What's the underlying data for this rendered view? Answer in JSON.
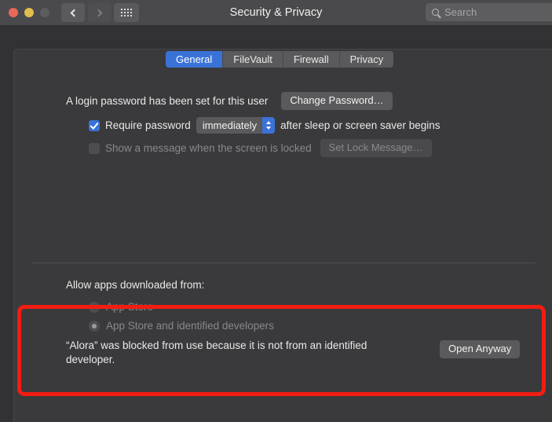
{
  "window": {
    "title": "Security & Privacy",
    "traffic_lights": [
      "close-button",
      "minimize-button",
      "zoom-button"
    ],
    "nav": {
      "back": "back-button",
      "forward": "forward-button",
      "show_all": "show-all-button"
    }
  },
  "search": {
    "placeholder": "Search",
    "value": ""
  },
  "tabs": [
    {
      "label": "General",
      "active": true
    },
    {
      "label": "FileVault",
      "active": false
    },
    {
      "label": "Firewall",
      "active": false
    },
    {
      "label": "Privacy",
      "active": false
    }
  ],
  "general": {
    "login_password_text": "A login password has been set for this user",
    "change_password_label": "Change Password…",
    "require_password": {
      "checked": true,
      "label": "Require password",
      "delay_value": "immediately",
      "suffix": "after sleep or screen saver begins"
    },
    "lock_message": {
      "checked": false,
      "label": "Show a message when the screen is locked",
      "button_label": "Set Lock Message…",
      "enabled": false
    },
    "allow_apps": {
      "heading": "Allow apps downloaded from:",
      "options": [
        {
          "label": "App Store",
          "selected": false,
          "enabled": false
        },
        {
          "label": "App Store and identified developers",
          "selected": true,
          "enabled": false
        }
      ]
    },
    "blocked_app": {
      "message": "“Alora” was blocked from use because it is not from an identified developer.",
      "button_label": "Open Anyway"
    }
  },
  "annotation": {
    "color": "#f11d13",
    "shape": "rectangle"
  },
  "colors": {
    "accent": "#3a72d8",
    "window_bg": "#323234",
    "panel_bg": "#3a3a3c",
    "titlebar_bg": "#4a4a4c",
    "annotation": "#f11d13"
  }
}
